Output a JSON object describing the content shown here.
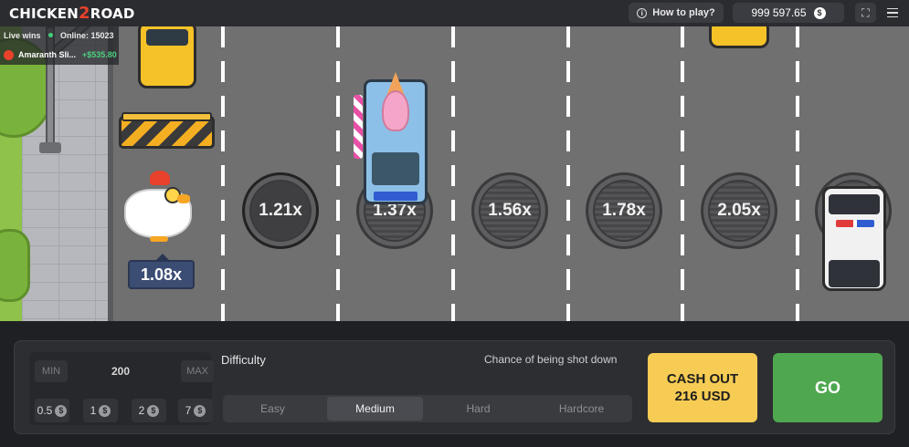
{
  "header": {
    "logo_part1": "CHICKEN",
    "logo_part2": "2",
    "logo_part3": "ROAD",
    "how_to_play": "How to play?",
    "balance": "999 597.65",
    "currency_symbol": "$"
  },
  "live": {
    "title": "Live wins",
    "online": "Online: 15023",
    "win": {
      "name": "Amaranth Sli...",
      "amount": "+$535.80"
    }
  },
  "game": {
    "chicken_multiplier": "1.08x",
    "lanes": [
      {
        "multiplier": "1.21x"
      },
      {
        "multiplier": "1.37x"
      },
      {
        "multiplier": "1.56x"
      },
      {
        "multiplier": "1.78x"
      },
      {
        "multiplier": "2.05x"
      }
    ]
  },
  "controls": {
    "min_label": "MIN",
    "bet_value": "200",
    "max_label": "MAX",
    "presets": [
      "0.5",
      "1",
      "2",
      "7"
    ],
    "preset_coin": "$",
    "difficulty_label": "Difficulty",
    "chance_label": "Chance of being shot down",
    "difficulties": [
      "Easy",
      "Medium",
      "Hard",
      "Hardcore"
    ],
    "selected_difficulty": "Medium",
    "cashout_line1": "CASH OUT",
    "cashout_line2": "216 USD",
    "go_label": "GO"
  },
  "colors": {
    "road": "#707070",
    "accent_yellow": "#f6cc54",
    "accent_green": "#4fa84f",
    "badge_blue": "#3c4d74"
  }
}
